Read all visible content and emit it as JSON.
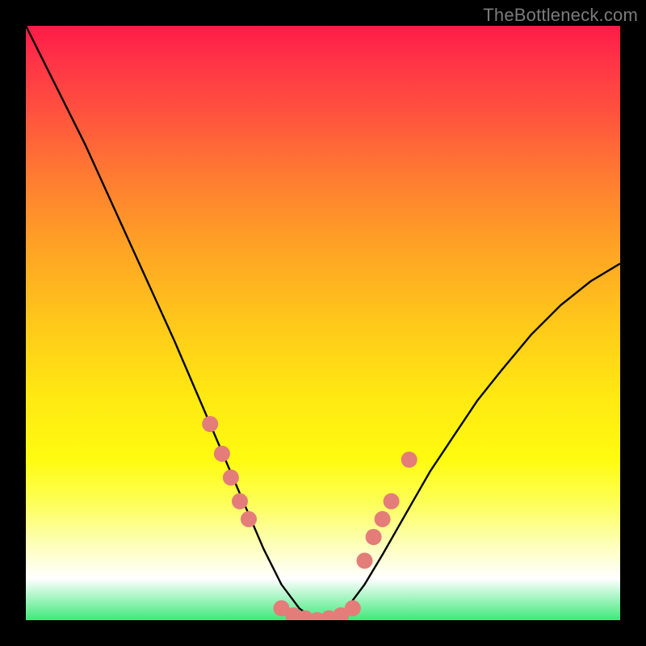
{
  "watermark": "TheBottleneck.com",
  "colors": {
    "background": "#000000",
    "curve_stroke": "#000000",
    "marker_fill": "#e47c7a",
    "gradient_top": "#ff1a47",
    "gradient_bottom": "#3ee97a"
  },
  "chart_data": {
    "type": "line",
    "title": "",
    "xlabel": "",
    "ylabel": "",
    "xlim": [
      0,
      100
    ],
    "ylim": [
      0,
      100
    ],
    "grid": false,
    "curve": {
      "x": [
        0,
        5,
        10,
        15,
        20,
        25,
        28,
        31,
        34,
        37,
        40,
        43,
        46,
        48,
        50,
        52,
        54,
        57,
        60,
        64,
        68,
        72,
        76,
        80,
        85,
        90,
        95,
        100
      ],
      "y": [
        100,
        90,
        80,
        69,
        58,
        47,
        40,
        33,
        26,
        19,
        12,
        6,
        2,
        0.5,
        0,
        0.5,
        2,
        6,
        11,
        18,
        25,
        31,
        37,
        42,
        48,
        53,
        57,
        60
      ]
    },
    "marker_series": [
      {
        "name": "left-cluster",
        "x": [
          31,
          33,
          34.5,
          36,
          37.5
        ],
        "y": [
          33,
          28,
          24,
          20,
          17
        ]
      },
      {
        "name": "bottom-cluster",
        "x": [
          43,
          45,
          47,
          49,
          51,
          53,
          55
        ],
        "y": [
          2,
          0.8,
          0.3,
          0,
          0.3,
          0.8,
          2
        ]
      },
      {
        "name": "right-cluster",
        "x": [
          57,
          58.5,
          60,
          61.5,
          64.5
        ],
        "y": [
          10,
          14,
          17,
          20,
          27
        ]
      }
    ]
  }
}
